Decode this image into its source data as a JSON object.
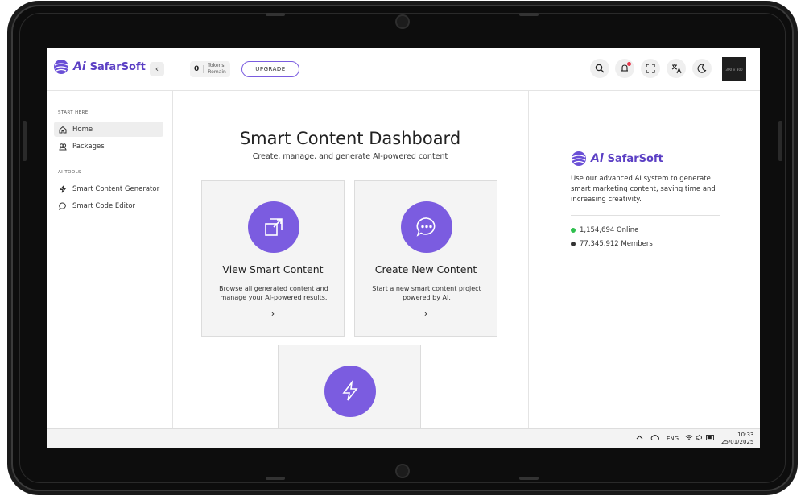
{
  "brand": {
    "name": "SafarSoft",
    "ai_mark": "Ai",
    "accent": "#7b5ce0"
  },
  "topbar": {
    "tokens_count": "0",
    "tokens_label_1": "Tokens",
    "tokens_label_2": "Remain",
    "upgrade_label": "UPGRADE",
    "icons": [
      "search-icon",
      "bell-icon",
      "fullscreen-icon",
      "translate-icon",
      "moon-icon"
    ],
    "avatar_text": "300 × 300"
  },
  "sidebar": {
    "section_start": "START HERE",
    "section_tools": "AI TOOLS",
    "items": [
      {
        "label": "Home",
        "icon": "home-icon",
        "active": true
      },
      {
        "label": "Packages",
        "icon": "packages-icon"
      },
      {
        "label": "Smart Content Generator",
        "icon": "bolt-icon"
      },
      {
        "label": "Smart Code Editor",
        "icon": "chat-icon"
      }
    ]
  },
  "main": {
    "title": "Smart Content Dashboard",
    "subtitle": "Create, manage, and generate AI-powered content",
    "cards": [
      {
        "title": "View Smart Content",
        "desc_1": "Browse all generated content and",
        "desc_2": "manage your AI-powered results.",
        "arrow": "›",
        "icon": "open-external-icon"
      },
      {
        "title": "Create New Content",
        "desc_1": "Start a new smart content project",
        "desc_2": "powered by AI.",
        "arrow": "›",
        "icon": "chat-bubble-icon"
      },
      {
        "title": "",
        "icon": "bolt-icon"
      }
    ]
  },
  "right_panel": {
    "description": "Use our advanced AI system to generate smart marketing content, saving time and increasing creativity.",
    "online": "1,154,694 Online",
    "members": "77,345,912 Members",
    "online_color": "#2fbf4e",
    "members_color": "#333333"
  },
  "taskbar": {
    "lang": "ENG",
    "time": "10:33",
    "date": "25/01/2025"
  }
}
